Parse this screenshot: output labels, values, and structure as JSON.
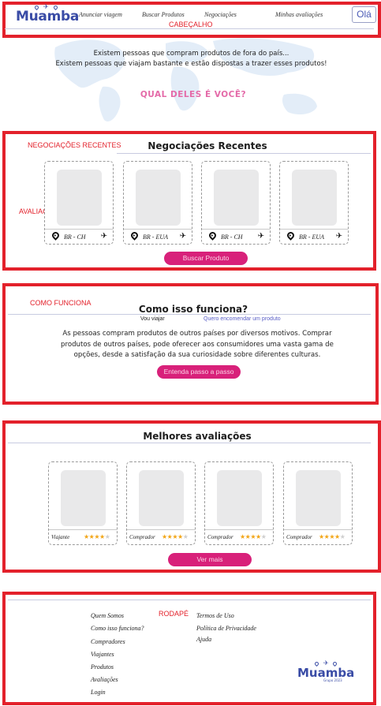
{
  "header": {
    "logo": "Muamba",
    "nav": [
      "Anunciar viagem",
      "Buscar Produtos",
      "Negociações",
      "Minhas avaliações"
    ],
    "greeting": "Olá",
    "region_label": "CABEÇALHO"
  },
  "hero": {
    "line1": "Existem pessoas que compram produtos de fora do país...",
    "line2": "Existem pessoas que viajam bastante e estão dispostas a trazer esses produtos!",
    "question": "QUAL DELES É VOCÊ?"
  },
  "recent": {
    "region_label": "NEGOCIAÇÕES RECENTES",
    "side_label": "AVALIAÇÕES",
    "title": "Negociações Recentes",
    "cards": [
      {
        "route": "BR - CH"
      },
      {
        "route": "BR - EUA"
      },
      {
        "route": "BR - CH"
      },
      {
        "route": "BR - EUA"
      }
    ],
    "button": "Buscar  Produto"
  },
  "how": {
    "region_label": "COMO FUNCIONA",
    "title": "Como isso funciona?",
    "tab_traveler": "Vou viajar",
    "tab_buyer": "Quero encomendar um produto",
    "text": "As pessoas compram produtos de outros países por diversos motivos. Comprar produtos de outros países, pode oferecer aos consumidores uma vasta gama de opções, desde a satisfação da sua curiosidade sobre diferentes culturas.",
    "button": "Entenda passo a passo"
  },
  "best": {
    "title": "Melhores avaliações",
    "cards": [
      {
        "role": "Viajante",
        "stars": 4
      },
      {
        "role": "Comprador",
        "stars": 4
      },
      {
        "role": "Comprador",
        "stars": 4
      },
      {
        "role": "Comprador",
        "stars": 4
      }
    ],
    "button": "Ver mais"
  },
  "footer": {
    "region_label": "RODAPÉ",
    "col1": [
      "Quem Somos",
      "Como isso funciona?",
      "Compradores",
      "Viajantes",
      "Produtos",
      "Avaliações",
      "Login"
    ],
    "col2": [
      "Termos de Uso",
      "Política de Privacidade",
      "Ajuda"
    ],
    "logo": "Muamba",
    "logo_sub": "Grupo 2023"
  },
  "colors": {
    "annotation_red": "#e3212b",
    "brand_blue": "#3a4ca6",
    "accent_pink": "#d8217a",
    "question_pink": "#e46aa8",
    "star": "#f2a516"
  }
}
